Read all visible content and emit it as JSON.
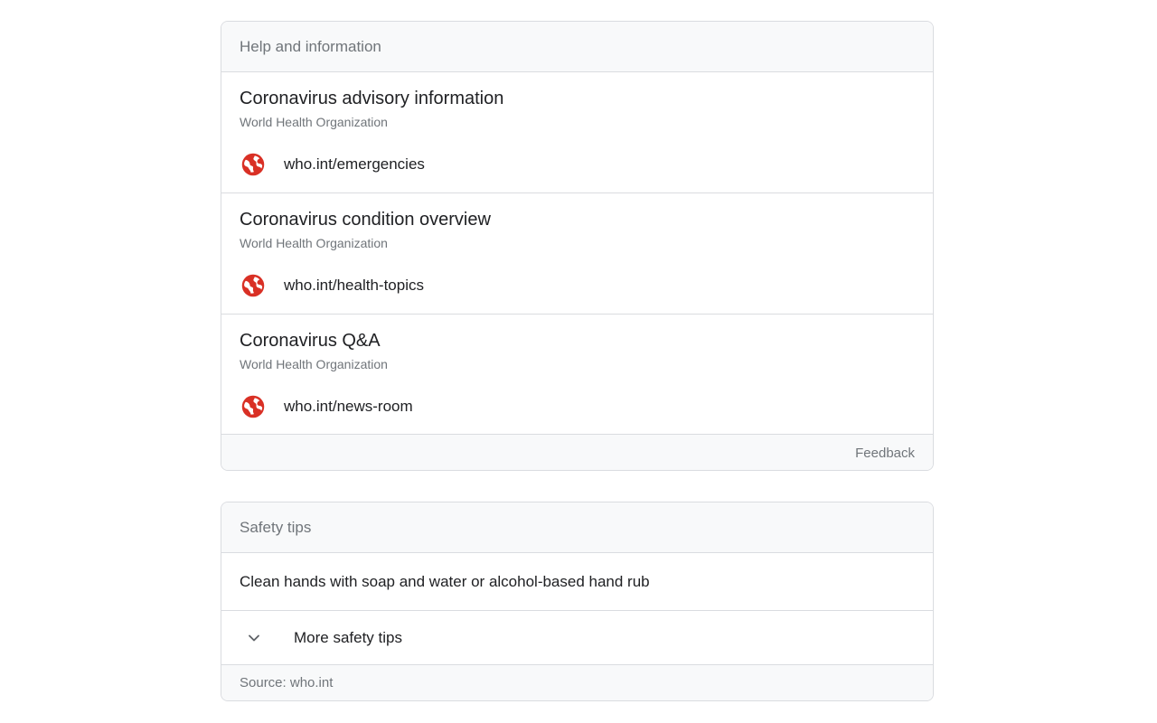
{
  "help_card": {
    "header": "Help and information",
    "items": [
      {
        "title": "Coronavirus advisory information",
        "source": "World Health Organization",
        "link": "who.int/emergencies",
        "icon": "globe-icon"
      },
      {
        "title": "Coronavirus condition overview",
        "source": "World Health Organization",
        "link": "who.int/health-topics",
        "icon": "globe-icon"
      },
      {
        "title": "Coronavirus Q&A",
        "source": "World Health Organization",
        "link": "who.int/news-room",
        "icon": "globe-icon"
      }
    ],
    "footer_label": "Feedback"
  },
  "safety_card": {
    "header": "Safety tips",
    "tip": "Clean hands with soap and water or alcohol-based hand rub",
    "more_label": "More safety tips",
    "more_icon": "chevron-down-icon",
    "source": "Source: who.int"
  },
  "colors": {
    "globe_icon": "#d93025",
    "muted_text": "#70757a",
    "primary_text": "#202124",
    "border": "#dadce0",
    "header_bg": "#f8f9fa"
  }
}
